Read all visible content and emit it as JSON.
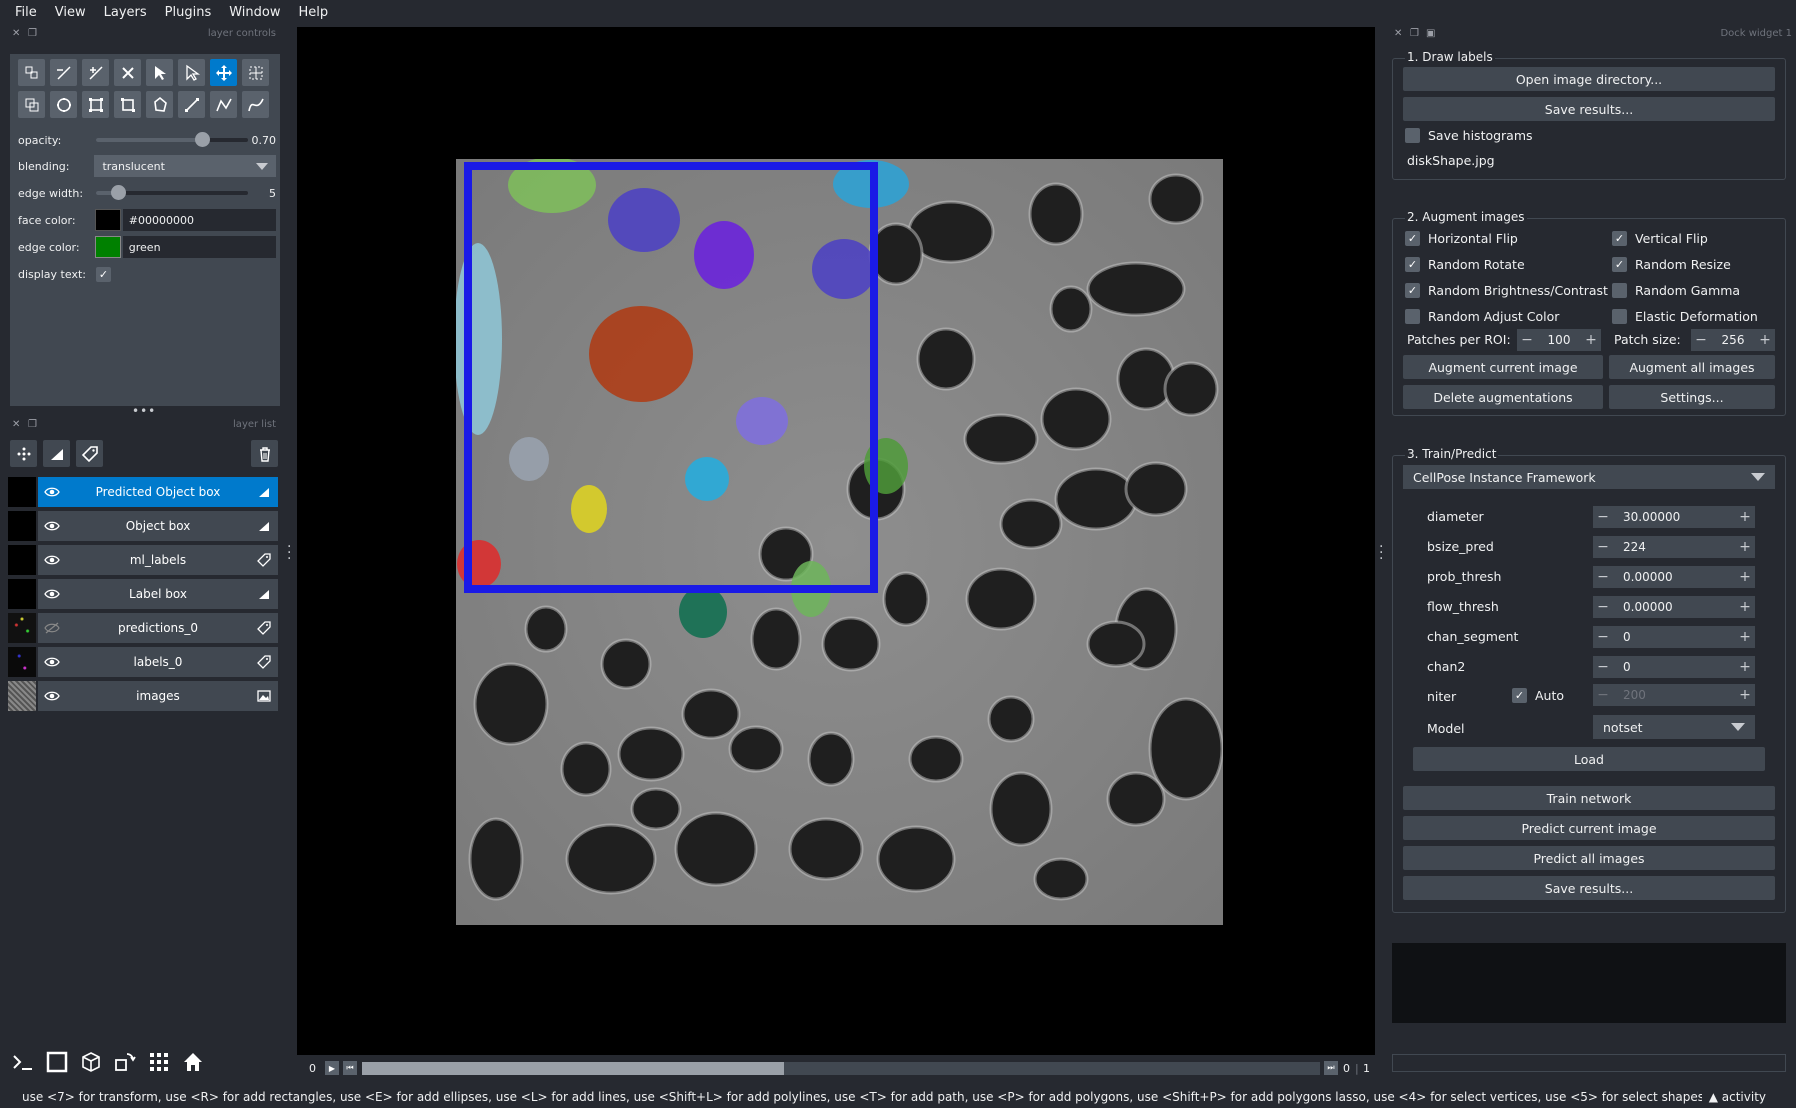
{
  "menu": [
    "File",
    "View",
    "Layers",
    "Plugins",
    "Window",
    "Help"
  ],
  "layer_controls": {
    "title": "layer controls",
    "tools_row1": [
      "select-points-icon",
      "vertex-remove-icon",
      "vertex-insert-icon",
      "delete-shape-icon",
      "select-shape-icon",
      "select-vertex-icon",
      "pan-zoom-icon",
      "transform-icon"
    ],
    "tools_row2": [
      "copy-icon",
      "ellipse-icon",
      "rectangle-icon",
      "rectangle-rotated-icon",
      "polygon-icon",
      "line-icon",
      "path-icon",
      "polyline-icon"
    ],
    "opacity_label": "opacity:",
    "opacity_value": "0.70",
    "opacity": 0.7,
    "blending_label": "blending:",
    "blending_value": "translucent",
    "edge_width_label": "edge width:",
    "edge_width_value": "5",
    "edge_width": 0.05,
    "face_color_label": "face color:",
    "face_color_value": "#00000000",
    "edge_color_label": "edge color:",
    "edge_color_value": "green",
    "edge_color_swatch": "#008000",
    "display_text_label": "display text:",
    "display_text_checked": true
  },
  "layer_list": {
    "title": "layer list",
    "layers": [
      {
        "name": "Predicted Object box",
        "type": "shapes-icon",
        "selected": true,
        "visible": true
      },
      {
        "name": "Object box",
        "type": "shapes-icon",
        "selected": false,
        "visible": true
      },
      {
        "name": "ml_labels",
        "type": "labels-icon",
        "selected": false,
        "visible": true
      },
      {
        "name": "Label box",
        "type": "shapes-icon",
        "selected": false,
        "visible": true
      },
      {
        "name": "predictions_0",
        "type": "labels-icon",
        "selected": false,
        "visible": false
      },
      {
        "name": "labels_0",
        "type": "labels-icon",
        "selected": false,
        "visible": true
      },
      {
        "name": "images",
        "type": "image-icon",
        "selected": false,
        "visible": true
      }
    ]
  },
  "dims": {
    "left_label": "0",
    "right_value": "0",
    "right_max": "1",
    "slider_position": 0.44
  },
  "status": {
    "message": "use <7> for transform, use <R> for add rectangles, use <E> for add ellipses, use <L> for add lines, use <Shift+L> for add polylines, use <T> for add path, use <P> for add polygons, use <Shift+P> for add polygons lasso, use <4> for select vertices, use <5> for select shapes, use ...",
    "activity": "activity"
  },
  "dock": {
    "title": "Dock widget 1",
    "draw_labels": {
      "title": "1. Draw labels",
      "open_button": "Open image directory...",
      "save_button": "Save results...",
      "save_histograms_label": "Save histograms",
      "save_histograms_checked": false,
      "filename": "diskShape.jpg"
    },
    "augment": {
      "title": "2. Augment images",
      "options": [
        {
          "label": "Horizontal Flip",
          "checked": true
        },
        {
          "label": "Vertical Flip",
          "checked": true
        },
        {
          "label": "Random Rotate",
          "checked": true
        },
        {
          "label": "Random Resize",
          "checked": true
        },
        {
          "label": "Random Brightness/Contrast",
          "checked": true
        },
        {
          "label": "Random Gamma",
          "checked": false
        },
        {
          "label": "Random Adjust Color",
          "checked": false
        },
        {
          "label": "Elastic Deformation",
          "checked": false
        }
      ],
      "patches_label": "Patches per ROI:",
      "patches_value": "100",
      "patch_size_label": "Patch size:",
      "patch_size_value": "256",
      "augment_current": "Augment current image",
      "augment_all": "Augment all images",
      "delete_aug": "Delete augmentations",
      "settings": "Settings..."
    },
    "train": {
      "title": "3. Train/Predict",
      "framework": "CellPose Instance Framework",
      "params": [
        {
          "label": "diameter",
          "value": "30.00000"
        },
        {
          "label": "bsize_pred",
          "value": "224"
        },
        {
          "label": "prob_thresh",
          "value": "0.00000"
        },
        {
          "label": "flow_thresh",
          "value": "0.00000"
        },
        {
          "label": "chan_segment",
          "value": "0"
        },
        {
          "label": "chan2",
          "value": "0"
        }
      ],
      "niter_label": "niter",
      "auto_label": "Auto",
      "auto_checked": true,
      "niter_value": "200",
      "model_label": "Model",
      "model_value": "notset",
      "load": "Load",
      "train_network": "Train network",
      "predict_current": "Predict current image",
      "predict_all": "Predict all images",
      "save_results": "Save results..."
    }
  },
  "canvas_colors": {
    "bbox": "#1a1ae6",
    "accent": "#007acc"
  }
}
